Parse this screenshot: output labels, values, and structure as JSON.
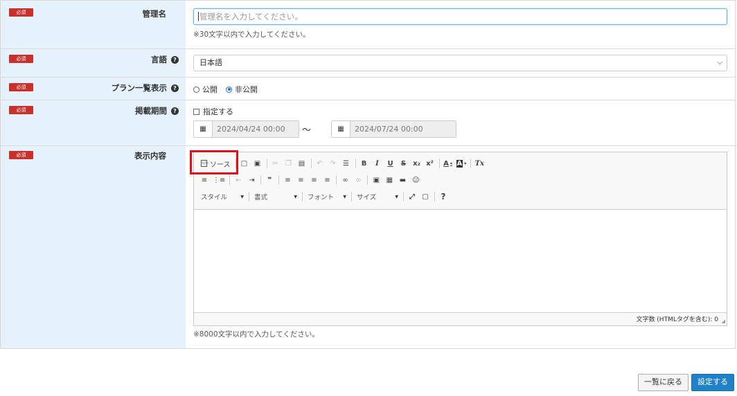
{
  "badges": {
    "required": "必須"
  },
  "fields": {
    "admin_name": {
      "label": "管理名",
      "placeholder": "管理名を入力してください。",
      "hint": "※30文字以内で入力してください。"
    },
    "language": {
      "label": "言語",
      "selected": "日本語"
    },
    "plan_list_display": {
      "label": "プラン一覧表示",
      "options": [
        {
          "label": "公開",
          "checked": false
        },
        {
          "label": "非公開",
          "checked": true
        }
      ]
    },
    "publish_period": {
      "label": "掲載期間",
      "checkbox_label": "指定する",
      "start": "2024/04/24 00:00",
      "separator": "〜",
      "end": "2024/07/24 00:00"
    },
    "display_content": {
      "label": "表示内容",
      "hint": "※8000文字以内で入力してください。"
    }
  },
  "editor": {
    "source_label": "ソース",
    "combos": {
      "style": "スタイル",
      "format": "書式",
      "font": "フォント",
      "size": "サイズ"
    },
    "word_count": "文字数 (HTMLタグを含む): 0",
    "toolbar_glyphs": {
      "bold": "B",
      "italic": "I",
      "underline": "U",
      "strike": "S",
      "subscript": "x₂",
      "superscript": "x²",
      "text_color": "A",
      "bg_color": "A",
      "remove_format": "Tx",
      "blockquote": "❞",
      "help": "?"
    }
  },
  "buttons": {
    "back": "一覧に戻る",
    "submit": "設定する"
  },
  "colors": {
    "required_badge": "#c9302c",
    "label_bg": "#e6f2fb",
    "submit_bg": "#1f82c9",
    "highlight": "#e0101b"
  }
}
